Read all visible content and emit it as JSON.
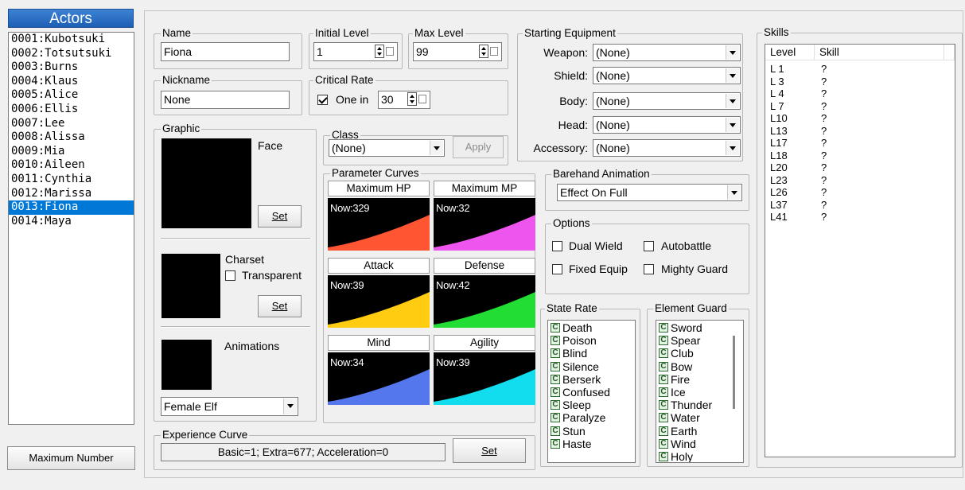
{
  "actors_panel": {
    "title": "Actors",
    "items": [
      "0001:Kubotsuki",
      "0002:Totsutsuki",
      "0003:Burns",
      "0004:Klaus",
      "0005:Alice",
      "0006:Ellis",
      "0007:Lee",
      "0008:Alissa",
      "0009:Mia",
      "0010:Aileen",
      "0011:Cynthia",
      "0012:Marissa",
      "0013:Fiona",
      "0014:Maya"
    ],
    "selected_index": 12,
    "max_button": "Maximum Number"
  },
  "name": {
    "label": "Name",
    "value": "Fiona"
  },
  "initial_level": {
    "label": "Initial Level",
    "value": "1"
  },
  "max_level": {
    "label": "Max Level",
    "value": "99"
  },
  "nickname": {
    "label": "Nickname",
    "value": "None"
  },
  "critical": {
    "label": "Critical Rate",
    "checkbox_label": "One in",
    "checked": true,
    "value": "30"
  },
  "graphic": {
    "label": "Graphic",
    "face_label": "Face",
    "set_label": "Set",
    "charset_label": "Charset",
    "transparent_label": "Transparent",
    "transparent_checked": false,
    "animations_label": "Animations",
    "animation_value": "Female Elf"
  },
  "class": {
    "label": "Class",
    "value": "(None)",
    "apply": "Apply"
  },
  "curves": {
    "label": "Parameter Curves",
    "items": [
      {
        "title": "Maximum HP",
        "now": "Now:329",
        "color": "#ff5533"
      },
      {
        "title": "Maximum MP",
        "now": "Now:32",
        "color": "#ee55ee"
      },
      {
        "title": "Attack",
        "now": "Now:39",
        "color": "#ffcc11"
      },
      {
        "title": "Defense",
        "now": "Now:42",
        "color": "#22dd33"
      },
      {
        "title": "Mind",
        "now": "Now:34",
        "color": "#5577ee"
      },
      {
        "title": "Agility",
        "now": "Now:39",
        "color": "#11ddee"
      }
    ]
  },
  "experience": {
    "label": "Experience Curve",
    "value": "Basic=1; Extra=677; Acceleration=0",
    "set": "Set"
  },
  "equipment": {
    "label": "Starting Equipment",
    "slots": [
      {
        "label": "Weapon:",
        "value": "(None)"
      },
      {
        "label": "Shield:",
        "value": "(None)"
      },
      {
        "label": "Body:",
        "value": "(None)"
      },
      {
        "label": "Head:",
        "value": "(None)"
      },
      {
        "label": "Accessory:",
        "value": "(None)"
      }
    ]
  },
  "barehand": {
    "label": "Barehand Animation",
    "value": "Effect On Full"
  },
  "options": {
    "label": "Options",
    "dual_wield": "Dual Wield",
    "autobattle": "Autobattle",
    "fixed_equip": "Fixed Equip",
    "mighty_guard": "Mighty Guard"
  },
  "state_rate": {
    "label": "State Rate",
    "grade": "C",
    "items": [
      "Death",
      "Poison",
      "Blind",
      "Silence",
      "Berserk",
      "Confused",
      "Sleep",
      "Paralyze",
      "Stun",
      "Haste"
    ]
  },
  "element_guard": {
    "label": "Element Guard",
    "grade": "C",
    "items": [
      "Sword",
      "Spear",
      "Club",
      "Bow",
      "Fire",
      "Ice",
      "Thunder",
      "Water",
      "Earth",
      "Wind",
      "Holy"
    ]
  },
  "skills": {
    "label": "Skills",
    "col_level": "Level",
    "col_skill": "Skill",
    "rows": [
      {
        "level": "L 1",
        "skill": "?"
      },
      {
        "level": "L 3",
        "skill": "?"
      },
      {
        "level": "L 4",
        "skill": "?"
      },
      {
        "level": "L 7",
        "skill": "?"
      },
      {
        "level": "L10",
        "skill": "?"
      },
      {
        "level": "L13",
        "skill": "?"
      },
      {
        "level": "L17",
        "skill": "?"
      },
      {
        "level": "L18",
        "skill": "?"
      },
      {
        "level": "L20",
        "skill": "?"
      },
      {
        "level": "L23",
        "skill": "?"
      },
      {
        "level": "L26",
        "skill": "?"
      },
      {
        "level": "L37",
        "skill": "?"
      },
      {
        "level": "L41",
        "skill": "?"
      }
    ]
  }
}
